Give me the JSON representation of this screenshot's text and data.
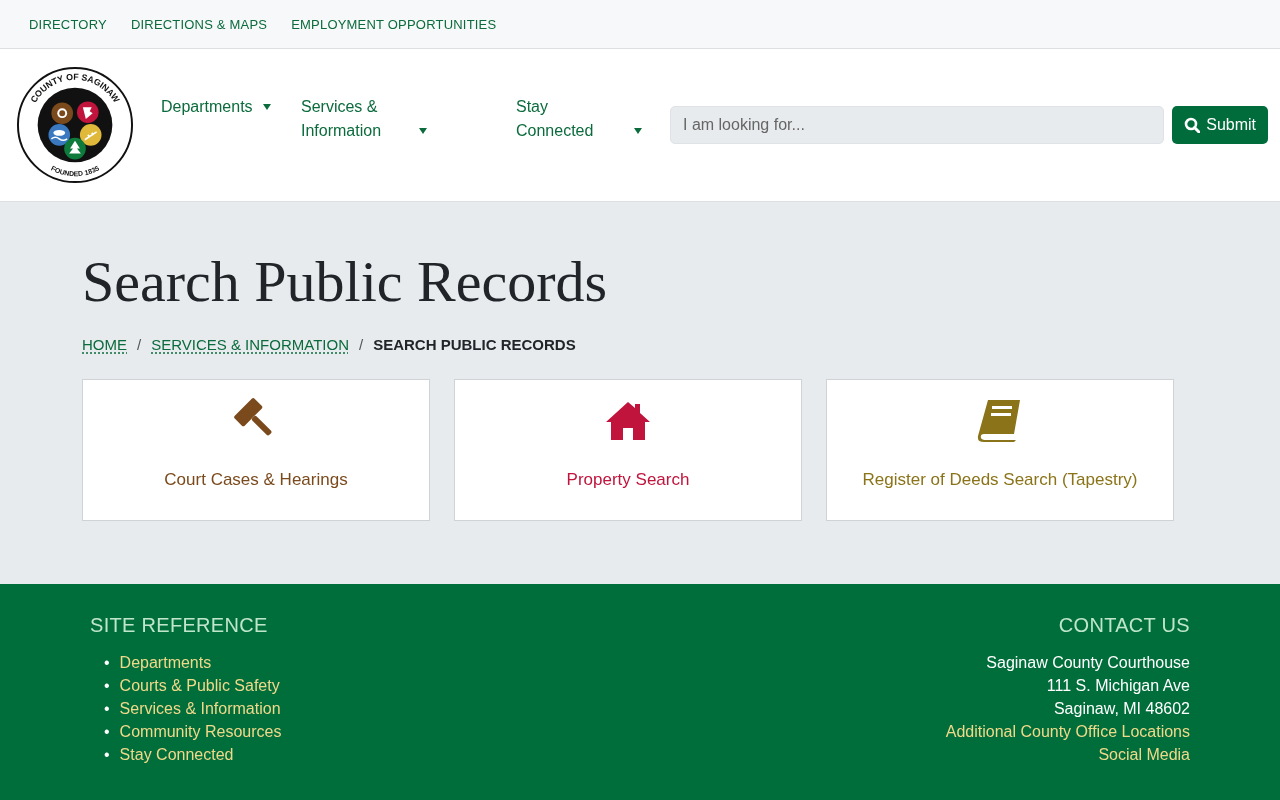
{
  "top_links": [
    "DIRECTORY",
    "DIRECTIONS & MAPS",
    "EMPLOYMENT OPPORTUNITIES"
  ],
  "logo": {
    "ring_top": "COUNTY OF SAGINAW",
    "ring_bottom": "FOUNDED 1835"
  },
  "nav": [
    {
      "label": "Departments",
      "expanded": false
    },
    {
      "label": "Services & Information",
      "expanded": false
    },
    {
      "label": "Stay Connected",
      "expanded": false
    }
  ],
  "search": {
    "placeholder": "I am looking for...",
    "button": "Submit"
  },
  "page": {
    "title": "Search Public Records",
    "breadcrumb": [
      {
        "label": "HOME",
        "current": false
      },
      {
        "label": "SERVICES & INFORMATION",
        "current": false
      },
      {
        "label": "SEARCH PUBLIC RECORDS",
        "current": true
      }
    ],
    "separator": "/"
  },
  "cards": [
    {
      "label": "Court Cases & Hearings",
      "color": "#7b4a1c"
    },
    {
      "label": "Property Search",
      "color": "#c0143c"
    },
    {
      "label": "Register of Deeds Search (Tapestry)",
      "color": "#8a7318"
    }
  ],
  "footer": {
    "site_reference": {
      "heading": "SITE REFERENCE",
      "bullet": "•",
      "links": [
        "Departments",
        "Courts & Public Safety",
        "Services & Information",
        "Community Resources",
        "Stay Connected"
      ]
    },
    "contact": {
      "heading": "CONTACT US",
      "address": [
        "Saginaw County Courthouse",
        "111 S. Michigan Ave",
        "Saginaw, MI 48602"
      ],
      "links": [
        "Additional County Office Locations",
        "Social Media"
      ]
    }
  }
}
